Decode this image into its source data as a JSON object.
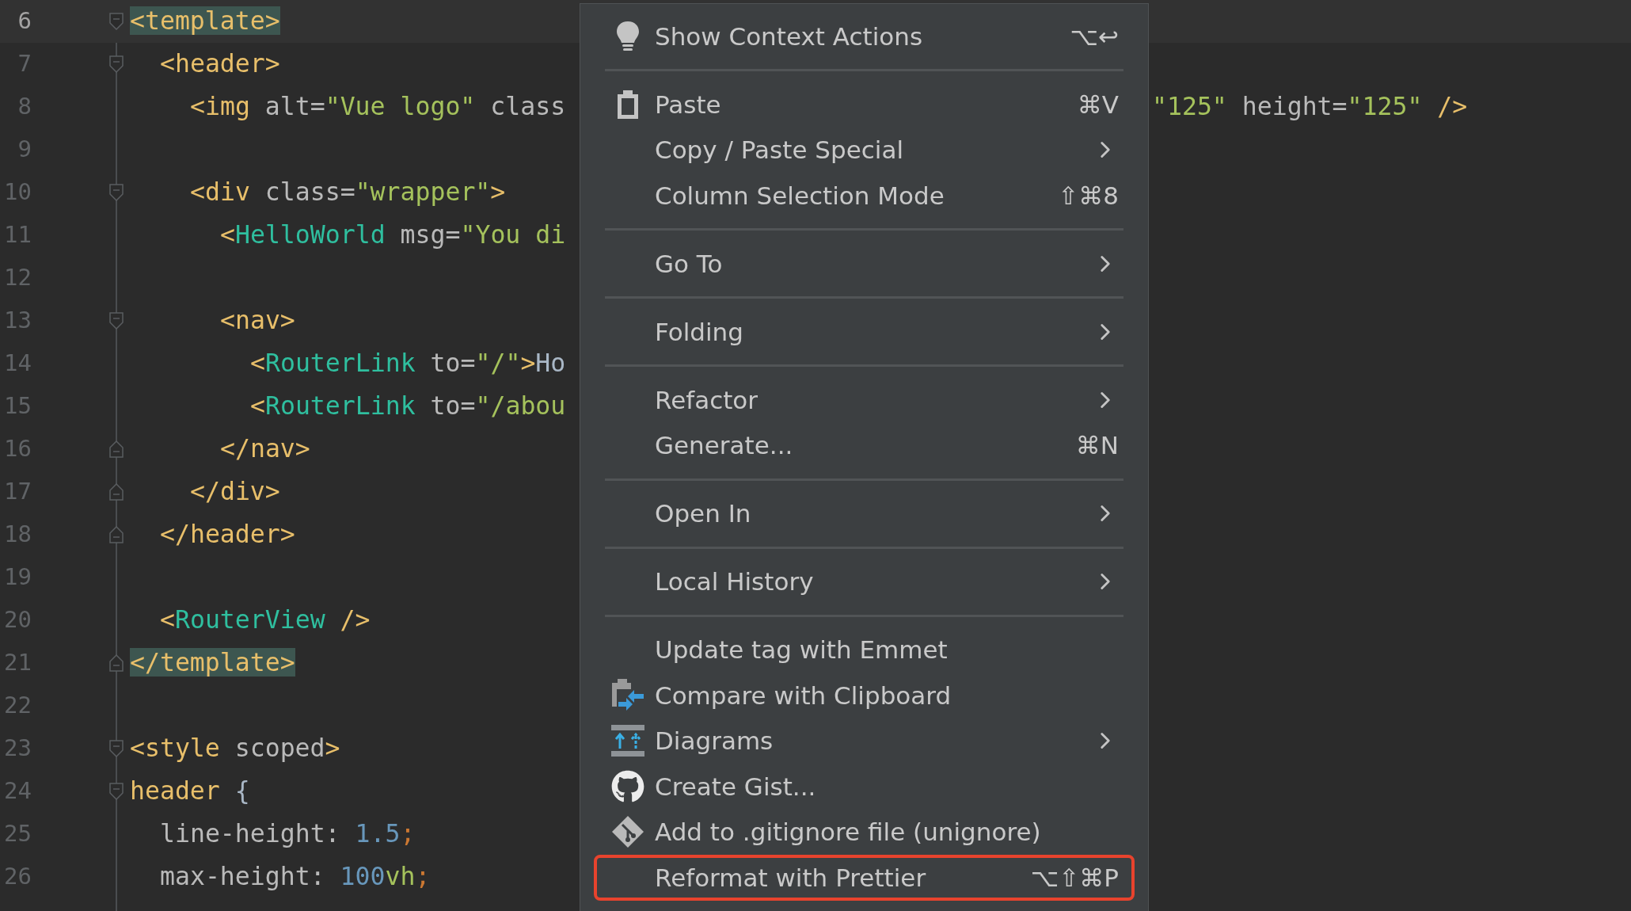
{
  "editor": {
    "lines": [
      {
        "number": "6",
        "current": true,
        "matched": true,
        "fold": {
          "kind": "start"
        },
        "tokens": [
          {
            "kind": "tag",
            "text": "<template>"
          }
        ],
        "children": [
          {
            "number": "7",
            "current": false,
            "matched": false,
            "fold": {
              "kind": "start"
            },
            "tokens": [
              {
                "kind": "tag",
                "text": "<header>"
              }
            ],
            "children": [
              {
                "number": "8",
                "current": false,
                "matched": false,
                "tokens": [
                  {
                    "kind": "tag",
                    "text": "<img"
                  },
                  {
                    "kind": "attr",
                    "text": " alt="
                  },
                  {
                    "kind": "string",
                    "text": "\"Vue logo\""
                  },
                  {
                    "kind": "attr",
                    "text": " class"
                  }
                ],
                "tokens_right": [
                  {
                    "kind": "string",
                    "text": "\"125\""
                  },
                  {
                    "kind": "attr",
                    "text": " height="
                  },
                  {
                    "kind": "string",
                    "text": "\"125\""
                  },
                  {
                    "kind": "tag",
                    "text": " />"
                  }
                ]
              },
              {
                "number": "9",
                "current": false
              },
              {
                "number": "10",
                "current": false,
                "matched": false,
                "fold": {
                  "kind": "start"
                },
                "tokens": [
                  {
                    "kind": "tag",
                    "text": "<div"
                  },
                  {
                    "kind": "attr",
                    "text": " class="
                  },
                  {
                    "kind": "string",
                    "text": "\"wrapper\""
                  },
                  {
                    "kind": "tag",
                    "text": ">"
                  }
                ],
                "children": [
                  {
                    "number": "11",
                    "current": false,
                    "matched": false,
                    "tokens": [
                      {
                        "kind": "tag",
                        "text": "<"
                      },
                      {
                        "kind": "component",
                        "text": "HelloWorld"
                      },
                      {
                        "kind": "attr",
                        "text": " msg="
                      },
                      {
                        "kind": "string",
                        "text": "\"You di"
                      }
                    ]
                  },
                  {
                    "number": "12",
                    "current": false
                  },
                  {
                    "number": "13",
                    "current": false,
                    "matched": false,
                    "fold": {
                      "kind": "start"
                    },
                    "tokens": [
                      {
                        "kind": "tag",
                        "text": "<nav>"
                      }
                    ],
                    "children": [
                      {
                        "number": "14",
                        "current": false,
                        "matched": false,
                        "tokens": [
                          {
                            "kind": "tag",
                            "text": "<"
                          },
                          {
                            "kind": "component",
                            "text": "RouterLink"
                          },
                          {
                            "kind": "attr",
                            "text": " to="
                          },
                          {
                            "kind": "string",
                            "text": "\"/\""
                          },
                          {
                            "kind": "tag",
                            "text": ">"
                          },
                          {
                            "kind": "text",
                            "text": "Ho"
                          }
                        ]
                      },
                      {
                        "number": "15",
                        "current": false,
                        "matched": false,
                        "tokens": [
                          {
                            "kind": "tag",
                            "text": "<"
                          },
                          {
                            "kind": "component",
                            "text": "RouterLink"
                          },
                          {
                            "kind": "attr",
                            "text": " to="
                          },
                          {
                            "kind": "string",
                            "text": "\"/abou"
                          }
                        ]
                      }
                    ]
                  },
                  {
                    "number": "16",
                    "current": false,
                    "matched": false,
                    "fold": {
                      "kind": "end"
                    },
                    "tokens": [
                      {
                        "kind": "tag",
                        "text": "</nav>"
                      }
                    ]
                  }
                ]
              },
              {
                "number": "17",
                "current": false,
                "matched": false,
                "fold": {
                  "kind": "end"
                },
                "tokens": [
                  {
                    "kind": "tag",
                    "text": "</div>"
                  }
                ]
              }
            ]
          },
          {
            "number": "18",
            "current": false,
            "matched": false,
            "fold": {
              "kind": "end"
            },
            "tokens": [
              {
                "kind": "tag",
                "text": "</header>"
              }
            ]
          },
          {
            "number": "19",
            "current": false
          },
          {
            "number": "20",
            "current": false,
            "matched": false,
            "tokens": [
              {
                "kind": "tag",
                "text": "<"
              },
              {
                "kind": "component",
                "text": "RouterView"
              },
              {
                "kind": "tag",
                "text": " />"
              }
            ]
          }
        ]
      },
      {
        "number": "21",
        "current": false,
        "matched": true,
        "fold": {
          "kind": "end"
        },
        "tokens": [
          {
            "kind": "tag",
            "text": "</template>"
          }
        ]
      },
      {
        "number": "22",
        "current": false
      },
      {
        "number": "23",
        "current": false,
        "matched": false,
        "fold": {
          "kind": "start"
        },
        "tokens": [
          {
            "kind": "tag",
            "text": "<style"
          },
          {
            "kind": "attr",
            "text": " scoped"
          },
          {
            "kind": "tag",
            "text": ">"
          }
        ]
      },
      {
        "number": "24",
        "current": false,
        "matched": false,
        "fold": {
          "kind": "start"
        },
        "tokens": [
          {
            "kind": "tag",
            "text": "header"
          },
          {
            "kind": "text",
            "text": " {"
          }
        ],
        "children": [
          {
            "number": "25",
            "current": false,
            "matched": false,
            "tokens": [
              {
                "kind": "attr",
                "text": "line-height: "
              },
              {
                "kind": "number",
                "text": "1.5"
              },
              {
                "kind": "punct",
                "text": ";"
              }
            ]
          },
          {
            "number": "26",
            "current": false,
            "matched": false,
            "tokens": [
              {
                "kind": "attr",
                "text": "max-height: "
              },
              {
                "kind": "number",
                "text": "100"
              },
              {
                "kind": "string",
                "text": "vh"
              },
              {
                "kind": "punct",
                "text": ";"
              }
            ]
          }
        ]
      }
    ]
  },
  "context_menu": {
    "items": [
      {
        "kind": "item",
        "label": "Show Context Actions",
        "shortcut": "⌥↩",
        "submenu": false,
        "outlined": false
      },
      {
        "kind": "separator"
      },
      {
        "kind": "item",
        "label": "Paste",
        "shortcut": "⌘V",
        "submenu": false,
        "outlined": false
      },
      {
        "kind": "item",
        "label": "Copy / Paste Special",
        "submenu": true,
        "outlined": false
      },
      {
        "kind": "item",
        "label": "Column Selection Mode",
        "shortcut": "⇧⌘8",
        "submenu": false,
        "outlined": false
      },
      {
        "kind": "separator"
      },
      {
        "kind": "item",
        "label": "Go To",
        "submenu": true,
        "outlined": false
      },
      {
        "kind": "separator"
      },
      {
        "kind": "item",
        "label": "Folding",
        "submenu": true,
        "outlined": false
      },
      {
        "kind": "separator"
      },
      {
        "kind": "item",
        "label": "Refactor",
        "submenu": true,
        "outlined": false
      },
      {
        "kind": "item",
        "label": "Generate...",
        "shortcut": "⌘N",
        "submenu": false,
        "outlined": false
      },
      {
        "kind": "separator"
      },
      {
        "kind": "item",
        "label": "Open In",
        "submenu": true,
        "outlined": false
      },
      {
        "kind": "separator"
      },
      {
        "kind": "item",
        "label": "Local History",
        "submenu": true,
        "outlined": false
      },
      {
        "kind": "separator"
      },
      {
        "kind": "item",
        "label": "Update tag with Emmet",
        "submenu": false,
        "outlined": false
      },
      {
        "kind": "item",
        "label": "Compare with Clipboard",
        "submenu": false,
        "outlined": false
      },
      {
        "kind": "item",
        "label": "Diagrams",
        "submenu": true,
        "outlined": false
      },
      {
        "kind": "item",
        "label": "Create Gist...",
        "submenu": false,
        "outlined": false
      },
      {
        "kind": "item",
        "label": "Add to .gitignore file (unignore)",
        "submenu": false,
        "outlined": false
      },
      {
        "kind": "item",
        "label": "Reformat with Prettier",
        "shortcut": "⌥⇧⌘P",
        "submenu": false,
        "outlined": true
      }
    ]
  }
}
